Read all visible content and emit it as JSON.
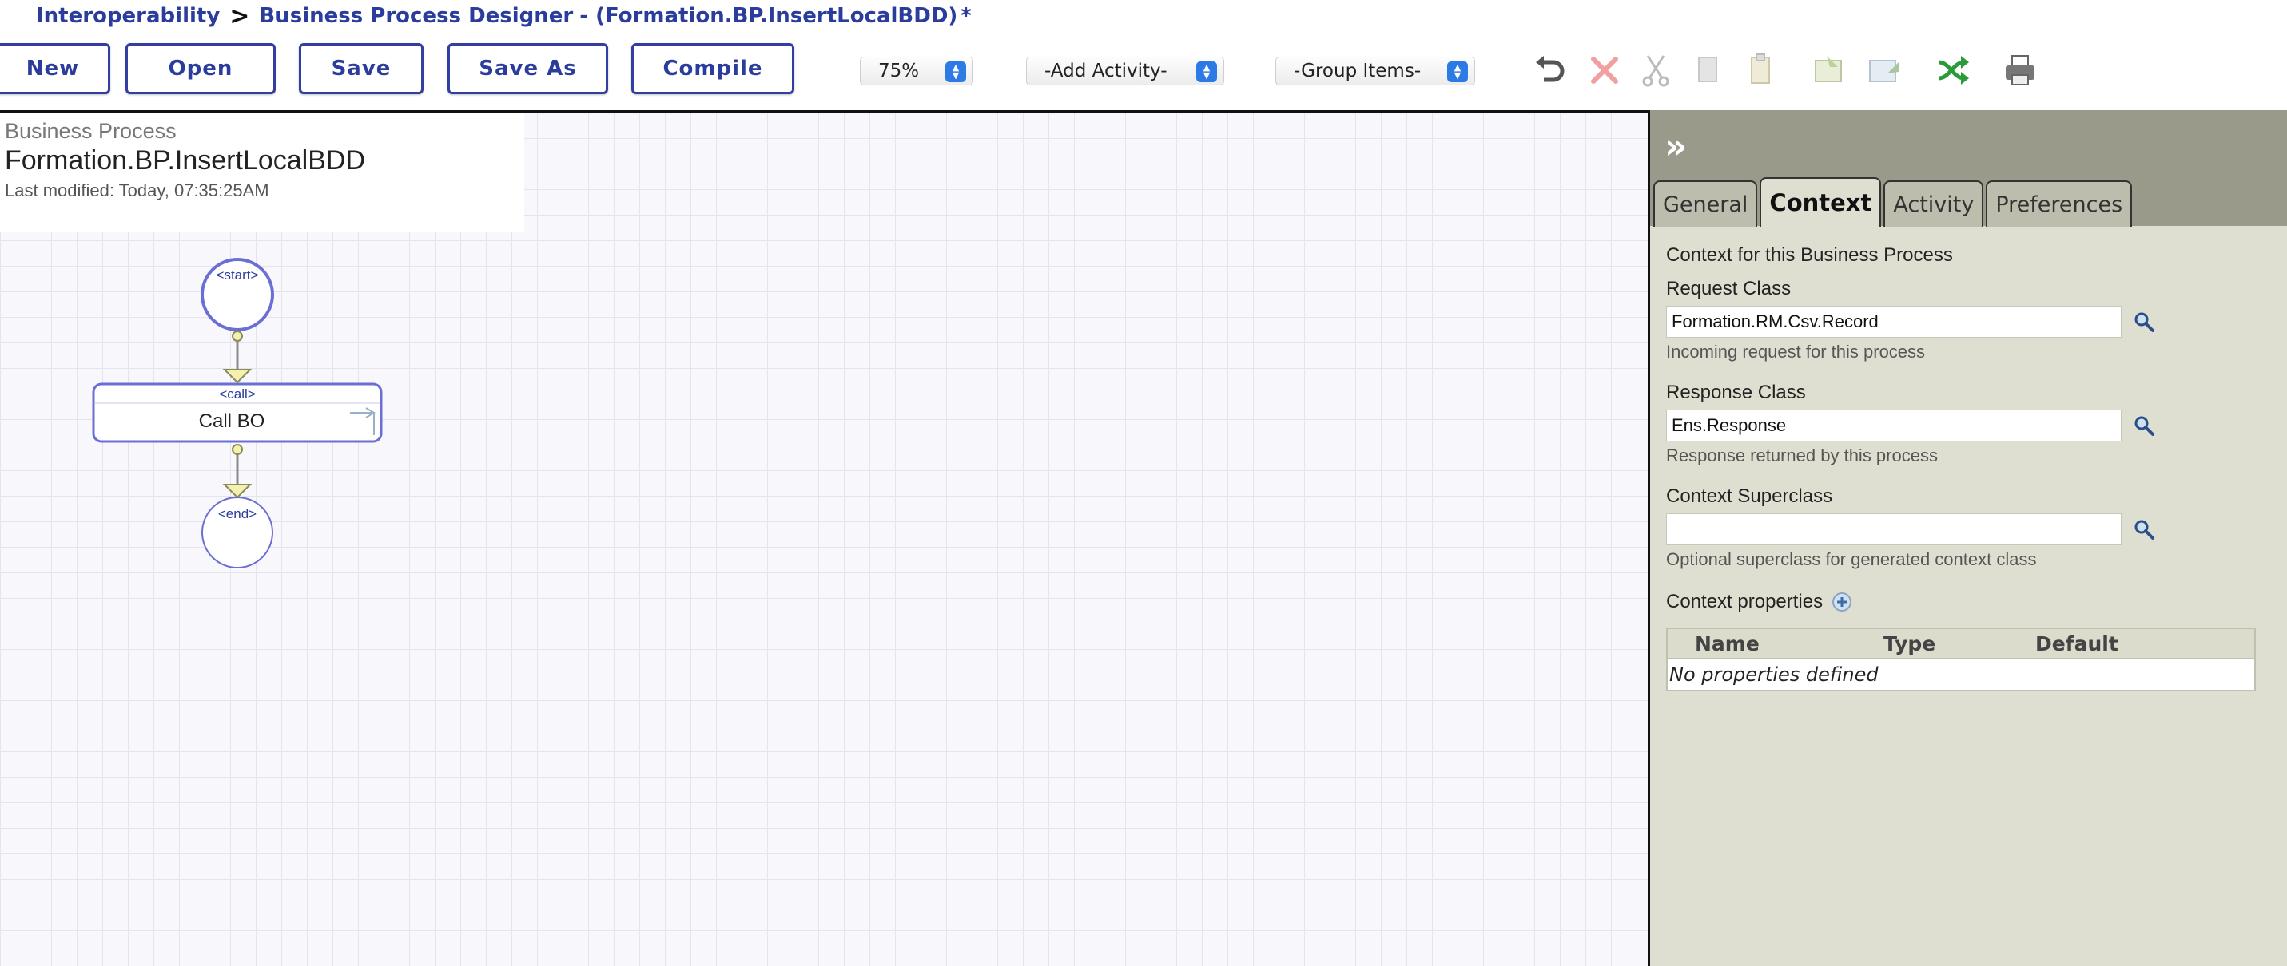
{
  "breadcrumb": {
    "root": "Interoperability",
    "separator": ">",
    "page": "Business Process Designer",
    "title": "- (Formation.BP.InsertLocalBDD)",
    "dirty_marker": "*"
  },
  "toolbar": {
    "new_label": "New",
    "open_label": "Open",
    "save_label": "Save",
    "save_as_label": "Save As",
    "compile_label": "Compile",
    "zoom_value": "75%",
    "add_activity_value": "-Add Activity-",
    "group_items_value": "-Group Items-",
    "icons": [
      "undo-icon",
      "delete-icon",
      "cut-icon",
      "copy-icon",
      "paste-icon",
      "import-icon",
      "export-icon",
      "shuffle-icon",
      "print-icon"
    ]
  },
  "canvas": {
    "bp_label": "Business Process",
    "bp_name": "Formation.BP.InsertLocalBDD",
    "last_modified": "Last modified: Today, 07:35:25AM",
    "nodes": {
      "start_label": "<start>",
      "call_label": "<call>",
      "call_name": "Call BO",
      "end_label": "<end>"
    }
  },
  "panel": {
    "collapse_glyph": "»",
    "tabs": [
      "General",
      "Context",
      "Activity",
      "Preferences"
    ],
    "active_tab": "Context",
    "heading": "Context for this Business Process",
    "request_class": {
      "label": "Request Class",
      "value": "Formation.RM.Csv.Record",
      "hint": "Incoming request for this process"
    },
    "response_class": {
      "label": "Response Class",
      "value": "Ens.Response",
      "hint": "Response returned by this process"
    },
    "context_superclass": {
      "label": "Context Superclass",
      "value": "",
      "hint": "Optional superclass for generated context class"
    },
    "context_properties": {
      "label": "Context properties",
      "columns": [
        "Name",
        "Type",
        "Default"
      ],
      "empty": "No properties defined"
    }
  },
  "colors": {
    "brand_blue": "#2b3d9c",
    "panel_bg": "#dfdfd1",
    "panel_header": "#9a9a8a",
    "node_stroke": "#6b6fd4"
  }
}
